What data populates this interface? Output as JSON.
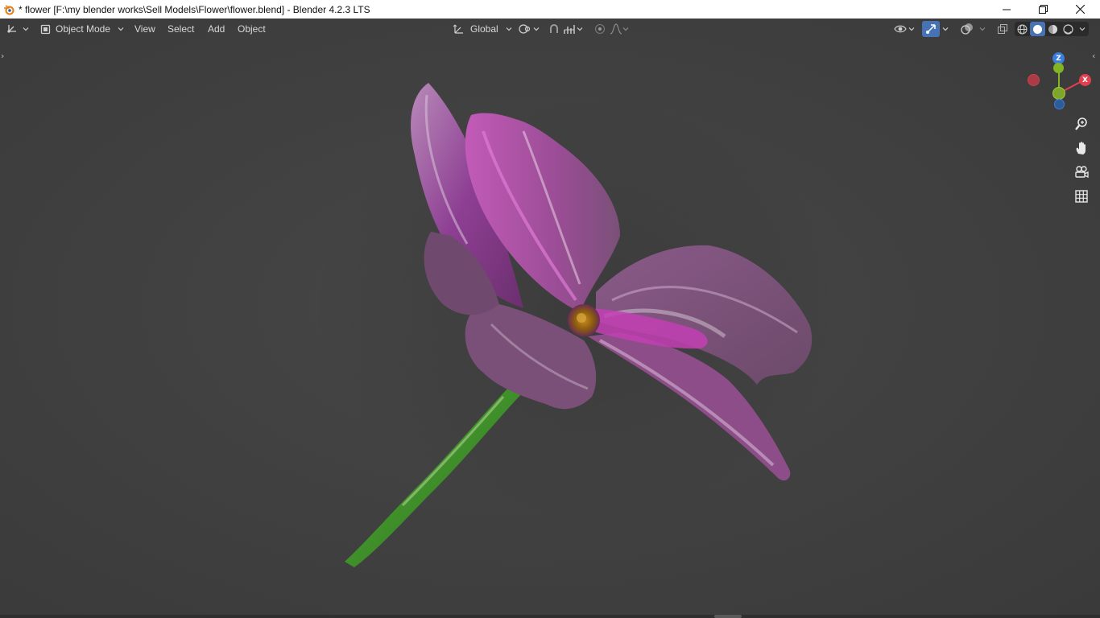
{
  "window": {
    "title": "* flower [F:\\my blender works\\Sell Models\\Flower\\flower.blend] - Blender 4.2.3 LTS",
    "controls": [
      "minimize-icon",
      "restore-icon",
      "close-icon"
    ]
  },
  "header": {
    "editor_type_icon": "3d-viewport-icon",
    "mode": {
      "icon": "object-mode-icon",
      "label": "Object Mode"
    },
    "menus": [
      "View",
      "Select",
      "Add",
      "Object"
    ],
    "transform_orientation": {
      "icon": "orientation-icon",
      "label": "Global"
    },
    "pivot_icon": "pivot-point-icon",
    "snap_icon": "snap-magnet-icon",
    "snap_target_icon": "snap-increment-icon",
    "proportional_icon": "proportional-edit-icon",
    "falloff_icon": "falloff-curve-icon",
    "right": {
      "visibility_icon": "eye-visibility-icon",
      "gizmo_icon": "gizmo-toggle-icon",
      "overlay_icon": "overlay-icon",
      "xray_icon": "xray-toggle-icon",
      "shading_modes": [
        "wireframe",
        "solid",
        "material-preview",
        "rendered"
      ],
      "active_shading": "solid"
    }
  },
  "gizmo": {
    "z_label": "Z",
    "x_label": "X",
    "colors": {
      "x": "#e04050",
      "y": "#83b425",
      "z": "#3b7ddd"
    }
  },
  "nav_buttons": [
    "zoom-icon",
    "pan-hand-icon",
    "camera-view-icon",
    "ortho-grid-icon"
  ],
  "scene": {
    "object": "flower",
    "colors": {
      "petal": "#8e3f93",
      "petal_light": "#c79ccb",
      "stem": "#4f9a2e",
      "center": "#b07a1a"
    }
  }
}
